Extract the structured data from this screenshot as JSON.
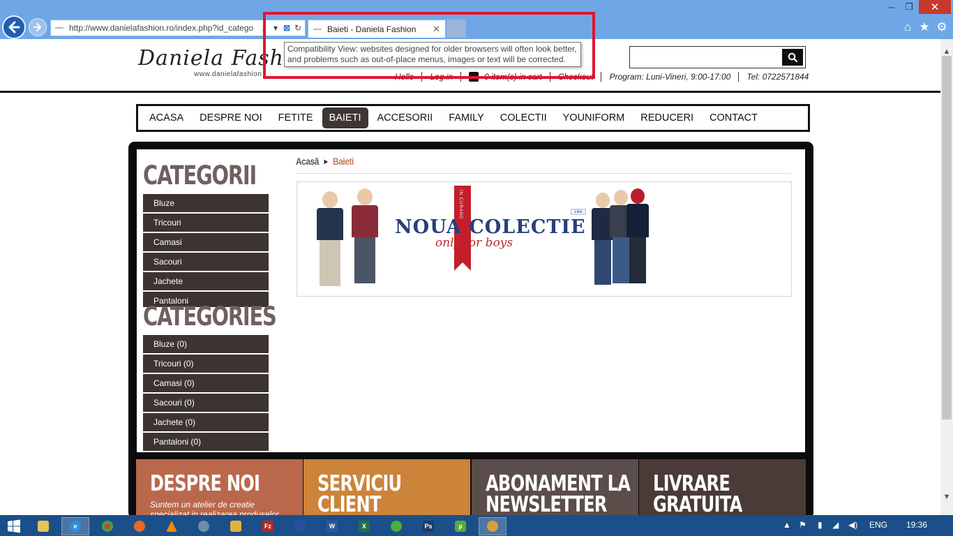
{
  "browser": {
    "url": "http://www.danielafashion.ro/index.php?id_catego",
    "tab_title": "Baieti - Daniela Fashion",
    "tab_close": "✕",
    "tooltip_line1": "Compatibility View: websites designed for older browsers will often look better,",
    "tooltip_line2": "and problems such as out-of-place menus, images or text will be corrected.",
    "search_glyph": "⌕",
    "dropdown_glyph": "▾",
    "compat_glyph": "⊠",
    "refresh_glyph": "↻",
    "win_min": "─",
    "win_max": "❐",
    "win_close": "✕",
    "home_glyph": "⌂",
    "fav_glyph": "★",
    "tools_glyph": "⚙"
  },
  "site": {
    "logo": "Daniela Fashion",
    "logo_sub": "www.danielafashion",
    "search_glyph": "⌕",
    "toplinks": {
      "hello": "Hello",
      "login": "Log in",
      "cart": "0 item(s) in cart",
      "checkout": "Checkout",
      "program": "Program: Luni-Vineri, 9:00-17:00",
      "tel": "Tel: 0722571844"
    }
  },
  "nav": {
    "items": [
      "ACASA",
      "DESPRE NOI",
      "FETITE",
      "BAIETI",
      "ACCESORII",
      "FAMILY",
      "COLECTII",
      "YOUNIFORM",
      "REDUCERI",
      "CONTACT"
    ],
    "active_index": 3
  },
  "sidebar": {
    "heading1": "CATEGORII",
    "list1": [
      "Bluze",
      "Tricouri",
      "Camasi",
      "Sacouri",
      "Jachete",
      "Pantaloni"
    ],
    "heading2": "CATEGORIES",
    "list2": [
      "Bluze (0)",
      "Tricouri (0)",
      "Camasi (0)",
      "Sacouri (0)",
      "Jachete (0)",
      "Pantaloni (0)"
    ]
  },
  "breadcrumb": {
    "home": "Acasă",
    "arrow": "▶",
    "current": "Baieti"
  },
  "banner": {
    "title": "NOUA COLECTIE",
    "subtitle": "only for boys",
    "ribbon": "IN CURAND",
    "like": "Like"
  },
  "footer": {
    "boxes": [
      {
        "title": "DESPRE NOI",
        "text": "Suntem un atelier de creatie",
        "text2": "specializat in realizarea produselor",
        "color": "#b9684c"
      },
      {
        "title": "SERVICIU",
        "title2": "CLIENT",
        "color": "#cc833a"
      },
      {
        "title": "ABONAMENT LA",
        "title2": "NEWSLETTER",
        "color": "#5a4d4a"
      },
      {
        "title": "LIVRARE",
        "title2": "GRATUITA",
        "color": "#4a3b38"
      }
    ]
  },
  "taskbar": {
    "lang": "ENG",
    "time": "19:36",
    "apps": [
      "windows-start",
      "file-explorer",
      "internet-explorer",
      "chrome",
      "firefox",
      "vlc",
      "calculator",
      "pencil-tool",
      "filezilla",
      "save-tool",
      "word",
      "excel",
      "green-app",
      "photoshop",
      "utorrent",
      "paint"
    ]
  },
  "colors": {
    "chrome_blue": "#6fa7e6",
    "nav_active": "#3f3634",
    "sidebar_item": "#3d3432",
    "heading": "#6f6160",
    "breadcrumb_current": "#c27a55",
    "highlight_red": "#e0162b"
  }
}
